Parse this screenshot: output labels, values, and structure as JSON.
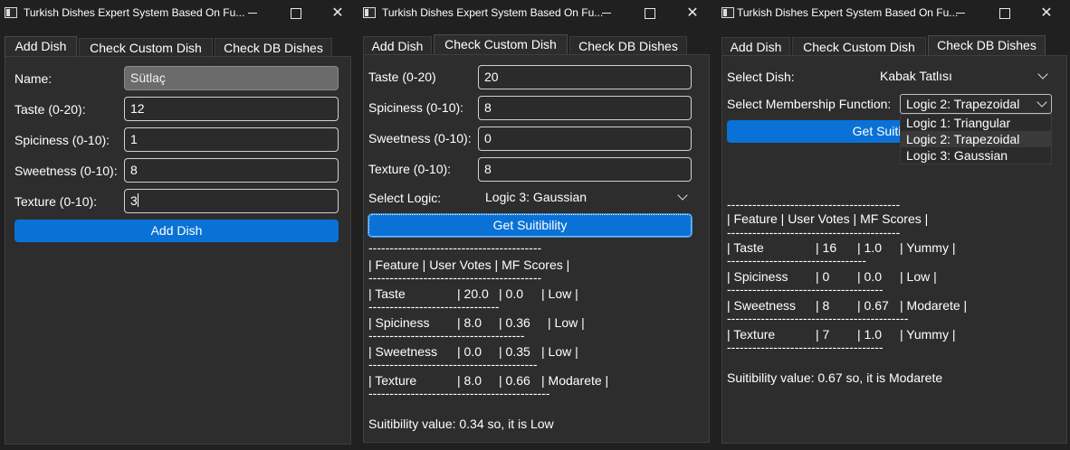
{
  "app_title": "Turkish Dishes Expert System Based On Fu...",
  "tabs": [
    "Add Dish",
    "Check Custom Dish",
    "Check DB Dishes"
  ],
  "window_controls": {
    "close": "✕"
  },
  "add_dish": {
    "name_label": "Name:",
    "name_value": "Sütlaç",
    "taste_label": "Taste (0-20):",
    "taste_value": "12",
    "spiciness_label": "Spiciness (0-10):",
    "spiciness_value": "1",
    "sweetness_label": "Sweetness (0-10):",
    "sweetness_value": "8",
    "texture_label": "Texture (0-10):",
    "texture_value": "3",
    "add_button": "Add Dish"
  },
  "custom_dish": {
    "taste_label": "Taste (0-20)",
    "taste_value": "20",
    "spiciness_label": "Spiciness (0-10):",
    "spiciness_value": "8",
    "sweetness_label": "Sweetness (0-10):",
    "sweetness_value": "0",
    "texture_label": "Texture (0-10):",
    "texture_value": "8",
    "logic_label": "Select Logic:",
    "logic_value": "Logic 3: Gaussian",
    "get_button": "Get Suitibility",
    "sep1": "-----------------------------------------",
    "header": "| Feature | User Votes | MF Scores |",
    "sep2": "-----------------------------------------",
    "rows": [
      {
        "feature": "| Taste",
        "votes": "| 20.0",
        "score": "| 0.0",
        "label": "| Low |"
      },
      {
        "feature": "| Spiciness",
        "votes": "| 8.0",
        "score": "| 0.36",
        "label": "| Low |"
      },
      {
        "feature": "| Sweetness",
        "votes": "| 0.0",
        "score": "| 0.35",
        "label": "| Low |"
      },
      {
        "feature": "| Texture",
        "votes": "| 8.0",
        "score": "| 0.66",
        "label": "| Modarete |"
      }
    ],
    "row_seps": [
      "-------------------------------",
      "-------------------------------------",
      "----------------------------------------",
      "-------------------------------------------"
    ],
    "result": "Suitibility value: 0.34 so, it is Low"
  },
  "db_dishes": {
    "dish_label": "Select Dish:",
    "dish_value": "Kabak Tatlısı",
    "mf_label": "Select Membership Function:",
    "mf_value": "Logic 2: Trapezoidal",
    "mf_options": [
      "Logic 1: Triangular",
      "Logic 2: Trapezoidal",
      "Logic 3: Gaussian"
    ],
    "get_button": "Get Suitibility",
    "sep1": "-----------------------------------------",
    "header": "| Feature | User Votes | MF Scores |",
    "sep2": "-----------------------------------------",
    "rows": [
      {
        "feature": "| Taste",
        "votes": "| 16",
        "score": "| 1.0",
        "label": "| Yummy |"
      },
      {
        "feature": "| Spiciness",
        "votes": "| 0",
        "score": "| 0.0",
        "label": "| Low |"
      },
      {
        "feature": "| Sweetness",
        "votes": "| 8",
        "score": "| 0.67",
        "label": "| Modarete |"
      },
      {
        "feature": "| Texture",
        "votes": "| 7",
        "score": "| 1.0",
        "label": "| Yummy |"
      }
    ],
    "row_seps": [
      "---------------------------------",
      "-------------------------------------",
      "-------------------------------------------",
      "-------------------------------------"
    ],
    "result": "Suitibility value: 0.67 so, it is Modarete"
  }
}
